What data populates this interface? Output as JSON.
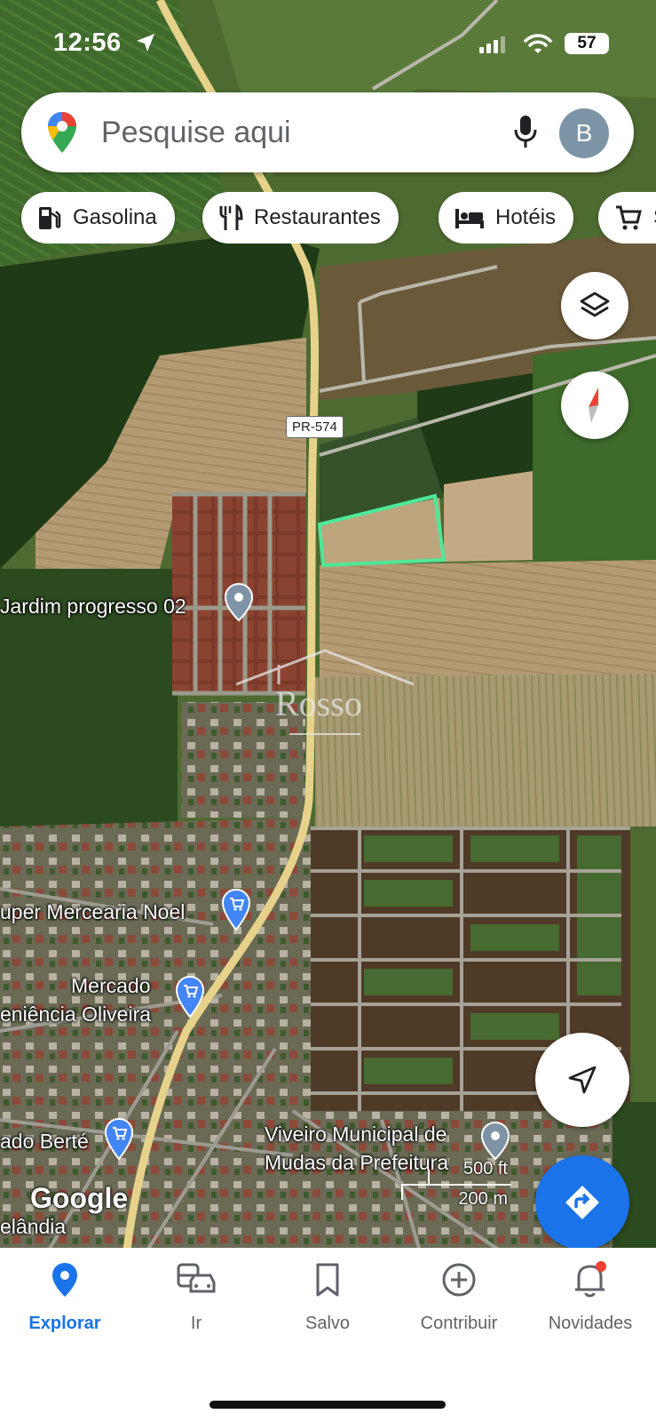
{
  "status_bar": {
    "time": "12:56",
    "battery": "57"
  },
  "search": {
    "placeholder": "Pesquise aqui",
    "avatar_letter": "B"
  },
  "chips": [
    {
      "label": "Gasolina",
      "icon": "gas-station-icon"
    },
    {
      "label": "Restaurantes",
      "icon": "restaurant-icon"
    },
    {
      "label": "Hotéis",
      "icon": "hotel-icon"
    },
    {
      "label": "S",
      "icon": "shopping-cart-icon"
    }
  ],
  "map": {
    "road_shield": "PR-574",
    "labels": {
      "jardim": "Jardim progresso 02",
      "mercearia": "uper Mercearia Noel",
      "mercado_line1": "Mercado",
      "mercado_line2": "eniência Oliveira",
      "berte": "ado Berté",
      "viveiro_line1": "Viveiro Municipal de",
      "viveiro_line2": "Mudas da Prefeitura",
      "town": "elândia"
    },
    "watermark": "Rosso",
    "attribution": "Google",
    "scale": {
      "imperial": "500 ft",
      "metric": "200 m"
    },
    "highlight_color": "#4ee89a"
  },
  "bottom_nav": [
    {
      "label": "Explorar",
      "icon": "explore-pin-icon",
      "active": true
    },
    {
      "label": "Ir",
      "icon": "commute-icon",
      "active": false
    },
    {
      "label": "Salvo",
      "icon": "bookmark-icon",
      "active": false
    },
    {
      "label": "Contribuir",
      "icon": "add-circle-icon",
      "active": false
    },
    {
      "label": "Novidades",
      "icon": "bell-icon",
      "active": false
    }
  ],
  "colors": {
    "accent": "#1a73e8",
    "notification_dot": "#ea4335"
  }
}
